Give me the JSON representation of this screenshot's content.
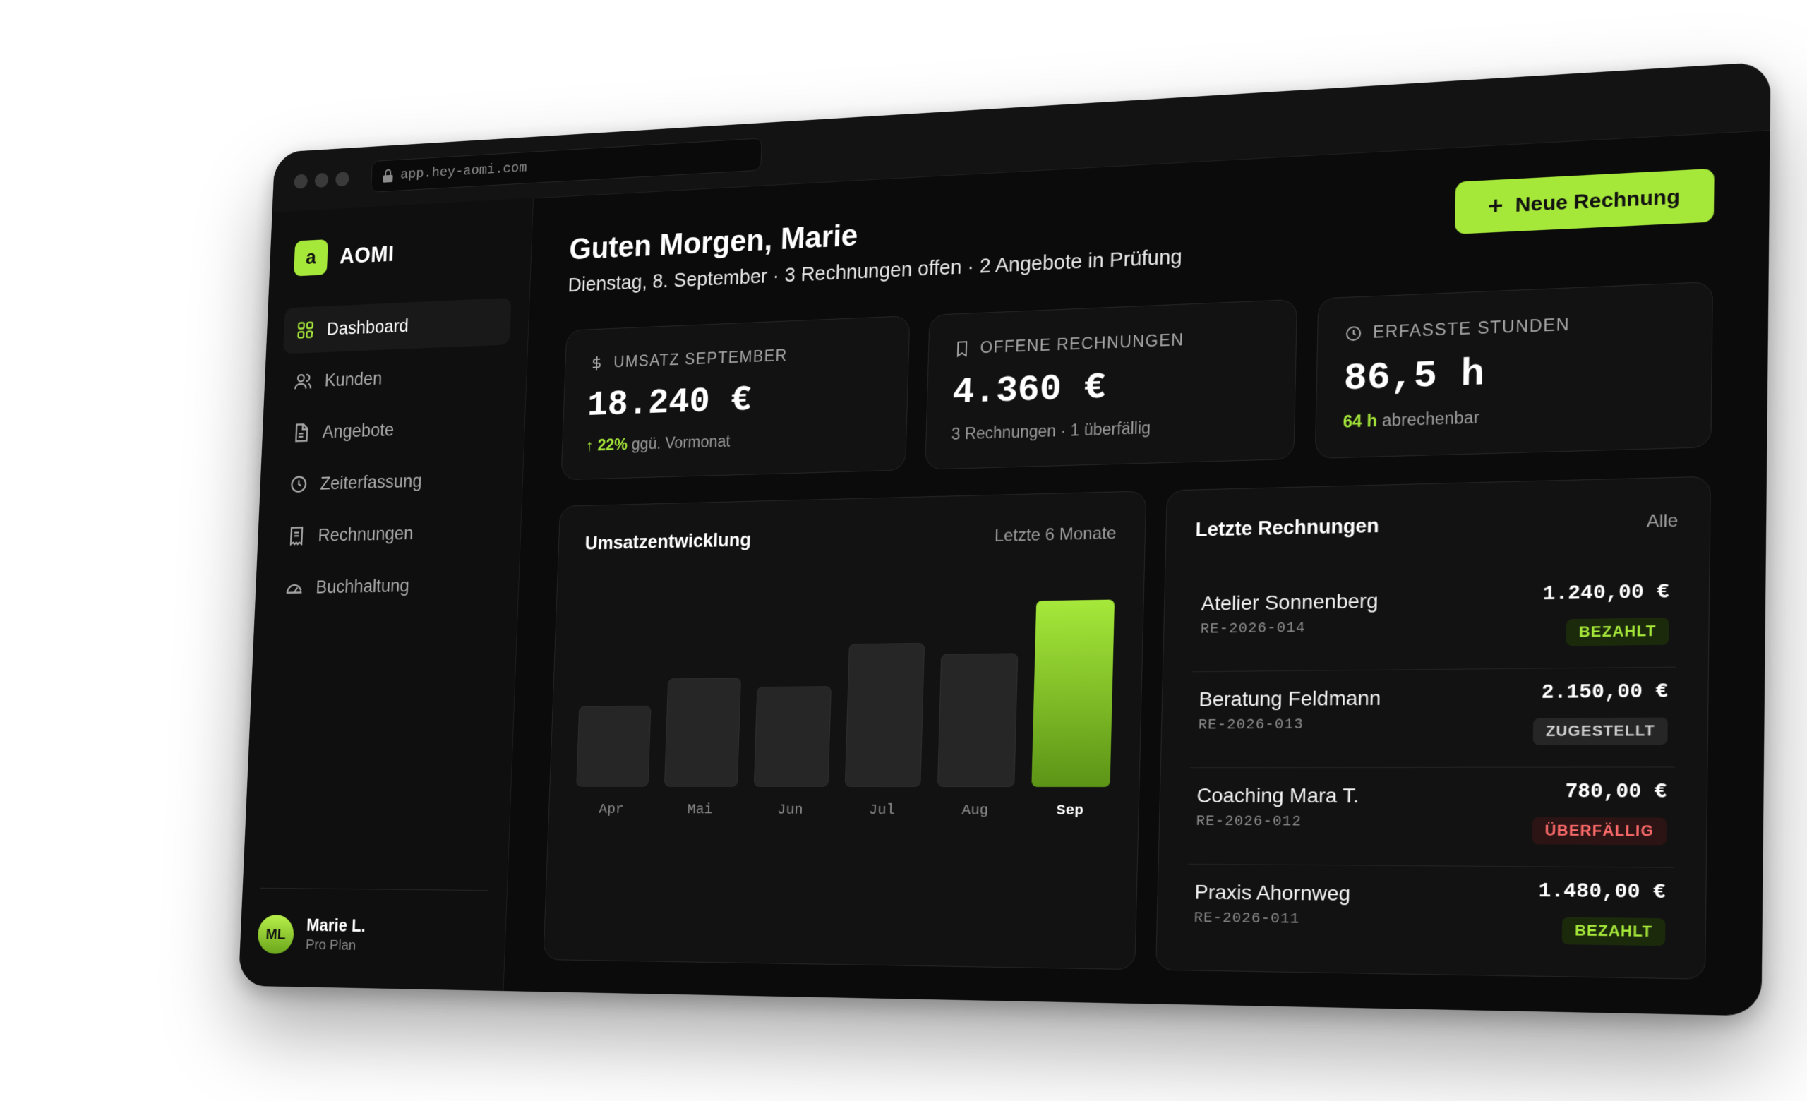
{
  "browser": {
    "url": "app.hey-aomi.com"
  },
  "brand": {
    "mark": "a",
    "name": "AOMI",
    "accent_color": "#a6e83a"
  },
  "sidebar": {
    "items": [
      {
        "label": "Dashboard",
        "icon": "grid-icon",
        "active": true
      },
      {
        "label": "Kunden",
        "icon": "users-icon",
        "active": false
      },
      {
        "label": "Angebote",
        "icon": "document-icon",
        "active": false
      },
      {
        "label": "Zeiterfassung",
        "icon": "clock-icon",
        "active": false
      },
      {
        "label": "Rechnungen",
        "icon": "receipt-icon",
        "active": false
      },
      {
        "label": "Buchhaltung",
        "icon": "gauge-icon",
        "active": false
      }
    ],
    "user": {
      "initials": "ML",
      "name": "Marie L.",
      "plan": "Pro Plan"
    }
  },
  "header": {
    "greeting": "Guten Morgen, Marie",
    "subline": "Dienstag, 8. September · 3 Rechnungen offen · 2 Angebote in Prüfung",
    "new_button": "Neue Rechnung"
  },
  "kpis": [
    {
      "icon": "dollar-icon",
      "label": "UMSATZ SEPTEMBER",
      "value": "18.240 €",
      "foot_highlight": "↑ 22%",
      "foot_text": " ggü. Vormonat"
    },
    {
      "icon": "bookmark-icon",
      "label": "OFFENE RECHNUNGEN",
      "value": "4.360 €",
      "foot_highlight": "",
      "foot_text": "3 Rechnungen · 1 überfällig"
    },
    {
      "icon": "clock-icon",
      "label": "ERFASSTE STUNDEN",
      "value": "86,5 h",
      "foot_highlight": "64 h",
      "foot_text": " abrechenbar"
    }
  ],
  "chart": {
    "title": "Umsatzentwicklung",
    "range_label": "Letzte 6 Monate"
  },
  "chart_data": {
    "type": "bar",
    "categories": [
      "Apr",
      "Mai",
      "Jun",
      "Jul",
      "Aug",
      "Sep"
    ],
    "values": [
      0.45,
      0.6,
      0.55,
      0.78,
      0.72,
      1.0
    ],
    "highlight": "Sep",
    "xlabel": "",
    "ylabel": ""
  },
  "invoices": {
    "title": "Letzte Rechnungen",
    "all_link": "Alle",
    "rows": [
      {
        "client": "Atelier Sonnenberg",
        "number": "RE-2026-014",
        "amount": "1.240,00 €",
        "status": "BEZAHLT",
        "kind": "paid"
      },
      {
        "client": "Beratung Feldmann",
        "number": "RE-2026-013",
        "amount": "2.150,00 €",
        "status": "ZUGESTELLT",
        "kind": "sent"
      },
      {
        "client": "Coaching Mara T.",
        "number": "RE-2026-012",
        "amount": "780,00 €",
        "status": "ÜBERFÄLLIG",
        "kind": "over"
      },
      {
        "client": "Praxis Ahornweg",
        "number": "RE-2026-011",
        "amount": "1.480,00 €",
        "status": "BEZAHLT",
        "kind": "paid"
      }
    ]
  }
}
